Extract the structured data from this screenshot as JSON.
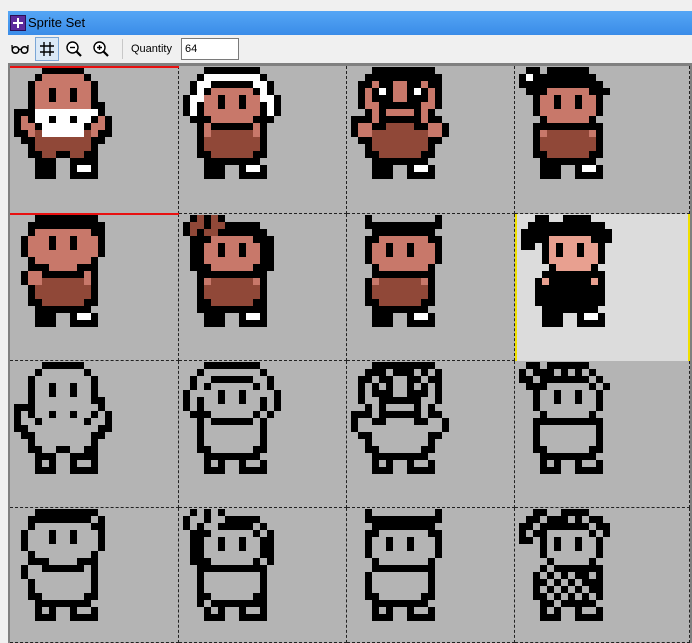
{
  "window": {
    "title": "Sprite Set"
  },
  "toolbar": {
    "quantity_label": "Quantity",
    "quantity_value": "64",
    "buttons": [
      {
        "name": "glasses-icon",
        "active": false
      },
      {
        "name": "grid-icon",
        "active": true
      },
      {
        "name": "zoom-out-icon",
        "active": false
      },
      {
        "name": "zoom-in-icon",
        "active": false
      }
    ]
  },
  "colors": {
    "title_bar": "#3a8ce8",
    "canvas_bg": "#b4b4b4",
    "selection": "#f0e000",
    "marker": "#e81010",
    "skin_dark": "#c8786a",
    "skin_light": "#e8a090",
    "cloth": "#904838",
    "outline": "#000000"
  },
  "sprite_set": {
    "columns": 4,
    "rows": 4,
    "selected_index": 7,
    "sprites": [
      {
        "kind": "bald-elder",
        "style": "color"
      },
      {
        "kind": "white-hair",
        "style": "color"
      },
      {
        "kind": "bearded",
        "style": "color"
      },
      {
        "kind": "ponytail",
        "style": "color"
      },
      {
        "kind": "boy",
        "style": "color"
      },
      {
        "kind": "flower-girl",
        "style": "color"
      },
      {
        "kind": "spiky-kid",
        "style": "color"
      },
      {
        "kind": "ponytail-light",
        "style": "color-light"
      },
      {
        "kind": "bald-elder",
        "style": "outline"
      },
      {
        "kind": "white-hair",
        "style": "outline"
      },
      {
        "kind": "bearded",
        "style": "outline"
      },
      {
        "kind": "ponytail",
        "style": "outline"
      },
      {
        "kind": "boy",
        "style": "outline"
      },
      {
        "kind": "flower-girl",
        "style": "outline"
      },
      {
        "kind": "spiky-kid",
        "style": "outline"
      },
      {
        "kind": "ponytail-light",
        "style": "outline"
      }
    ]
  }
}
